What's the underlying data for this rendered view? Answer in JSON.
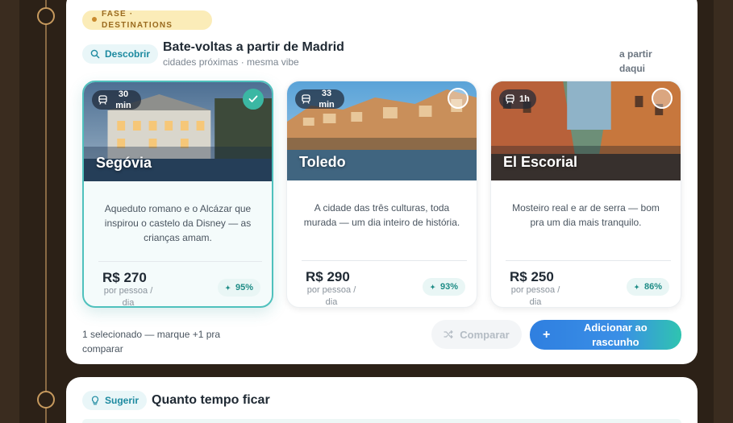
{
  "phase": {
    "label": "FASE · DESTINATIONS"
  },
  "section": {
    "tag": "Descobrir",
    "title": "Bate-voltas a partir de Madrid",
    "subtitle": "cidades próximas · mesma vibe",
    "hint": "a partir daqui"
  },
  "destinations": [
    {
      "city": "Segóvia",
      "duration": "30 min",
      "description": "Aqueduto romano e o Alcázar que inspirou o castelo da Disney — as crianças amam.",
      "price": "R$ 270",
      "per": "por pessoa / dia",
      "match": "95%",
      "selected": true
    },
    {
      "city": "Toledo",
      "duration": "33 min",
      "description": "A cidade das três culturas, toda murada — um dia inteiro de história.",
      "price": "R$ 290",
      "per": "por pessoa / dia",
      "match": "93%",
      "selected": false
    },
    {
      "city": "El Escorial",
      "duration": "1h",
      "description": "Mosteiro real e ar de serra — bom pra um dia mais tranquilo.",
      "price": "R$ 250",
      "per": "por pessoa / dia",
      "match": "86%",
      "selected": false
    }
  ],
  "footer": {
    "note": "1 selecionado — marque +1 pra comparar",
    "compare_label": "Comparar",
    "add_label": "Adicionar ao rascunho"
  },
  "next_section": {
    "tag": "Sugerir",
    "title": "Quanto tempo ficar"
  },
  "colors": {
    "accent_teal": "#3bb7a3",
    "accent_blue": "#2f7fe0",
    "phase_badge": "#fbecb8"
  },
  "icons": [
    "search-icon",
    "train-icon",
    "check-icon",
    "shuffle-icon",
    "plus-icon",
    "bulb-icon",
    "sparkle-icon"
  ]
}
